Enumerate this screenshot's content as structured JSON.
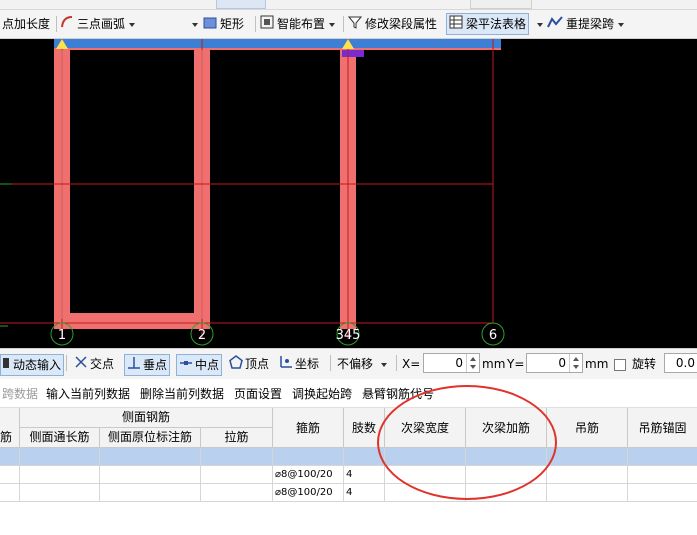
{
  "toolbar": {
    "add_length": "点加长度",
    "three_point_arc": "三点画弧",
    "rectangle": "矩形",
    "smart_layout": "智能布置",
    "edit_segment_attr": "修改梁段属性",
    "beam_table": "梁平法表格",
    "re_span": "重提梁跨"
  },
  "canvas": {
    "axis_labels": [
      "1",
      "2",
      "345",
      "6"
    ]
  },
  "snap_bar": {
    "dynamic_input": "动态输入",
    "intersection": "交点",
    "perpendicular": "垂点",
    "midpoint": "中点",
    "vertex": "顶点",
    "coordinate": "坐标",
    "offset_mode": "不偏移",
    "x_label": "X=",
    "x_value": "0",
    "x_unit": "mm",
    "y_label": "Y=",
    "y_value": "0",
    "y_unit": "mm",
    "rotate_label": "旋转",
    "rotate_value": "0.0"
  },
  "table_menu": {
    "item0": "跨数据",
    "item1": "输入当前列数据",
    "item2": "删除当前列数据",
    "item3": "页面设置",
    "item4": "调换起始跨",
    "item5": "悬臂钢筋代号"
  },
  "grid": {
    "group_side_rebar": "侧面钢筋",
    "col_partial": "筋",
    "col_side_long": "侧面通长筋",
    "col_side_orig": "侧面原位标注筋",
    "col_tie": "拉筋",
    "col_stirrup": "箍筋",
    "col_legs": "肢数",
    "col_sec_width": "次梁宽度",
    "col_sec_add": "次梁加筋",
    "col_hanger": "吊筋",
    "col_hanger_anchor": "吊筋锚固",
    "rows": [
      {
        "stirrup": "",
        "legs": ""
      },
      {
        "stirrup": "⌀8@100/20",
        "legs": "4"
      },
      {
        "stirrup": "⌀8@100/20",
        "legs": "4"
      }
    ]
  }
}
